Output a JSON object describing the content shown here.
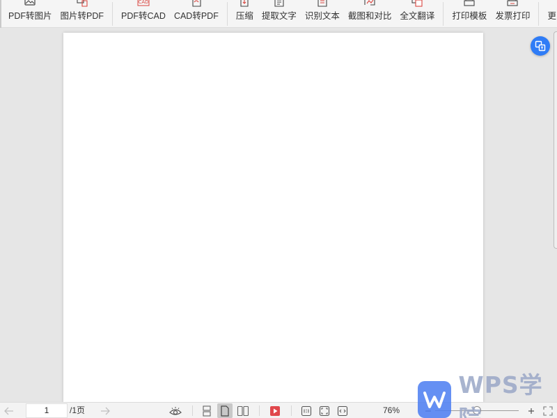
{
  "toolbar": {
    "groups": [
      [
        {
          "id": "pdf-to-image",
          "label": "PDF转图片",
          "icon": "image-icon"
        },
        {
          "id": "image-to-pdf",
          "label": "图片转PDF",
          "icon": "image-pdf-icon"
        }
      ],
      [
        {
          "id": "pdf-to-cad",
          "label": "PDF转CAD",
          "icon": "cad-icon",
          "icon_text": "CAD"
        },
        {
          "id": "cad-to-pdf",
          "label": "CAD转PDF",
          "icon": "cad-pdf-icon"
        }
      ],
      [
        {
          "id": "compress",
          "label": "压缩",
          "icon": "compress-icon"
        },
        {
          "id": "extract-text",
          "label": "提取文字",
          "icon": "extract-text-icon"
        },
        {
          "id": "recognize-text",
          "label": "识别文本",
          "icon": "ocr-icon"
        },
        {
          "id": "screenshot-compare",
          "label": "截图和对比",
          "icon": "screenshot-icon"
        },
        {
          "id": "full-translate",
          "label": "全文翻译",
          "icon": "translate-icon"
        }
      ],
      [
        {
          "id": "print-template",
          "label": "打印模板",
          "icon": "print-template-icon"
        },
        {
          "id": "invoice-print",
          "label": "发票打印",
          "icon": "invoice-print-icon"
        }
      ],
      [
        {
          "id": "more-apps",
          "label": "更多应用",
          "icon": "apps-icon"
        }
      ]
    ]
  },
  "status": {
    "current_page": "1",
    "total_pages": "/1页",
    "zoom": "76%",
    "zoom_level": 0.5
  },
  "watermark": {
    "text": "WPS学院"
  },
  "colors": {
    "accent": "#2f7cf6",
    "pdf_red": "#d9453f",
    "play_red": "#e0474c"
  }
}
